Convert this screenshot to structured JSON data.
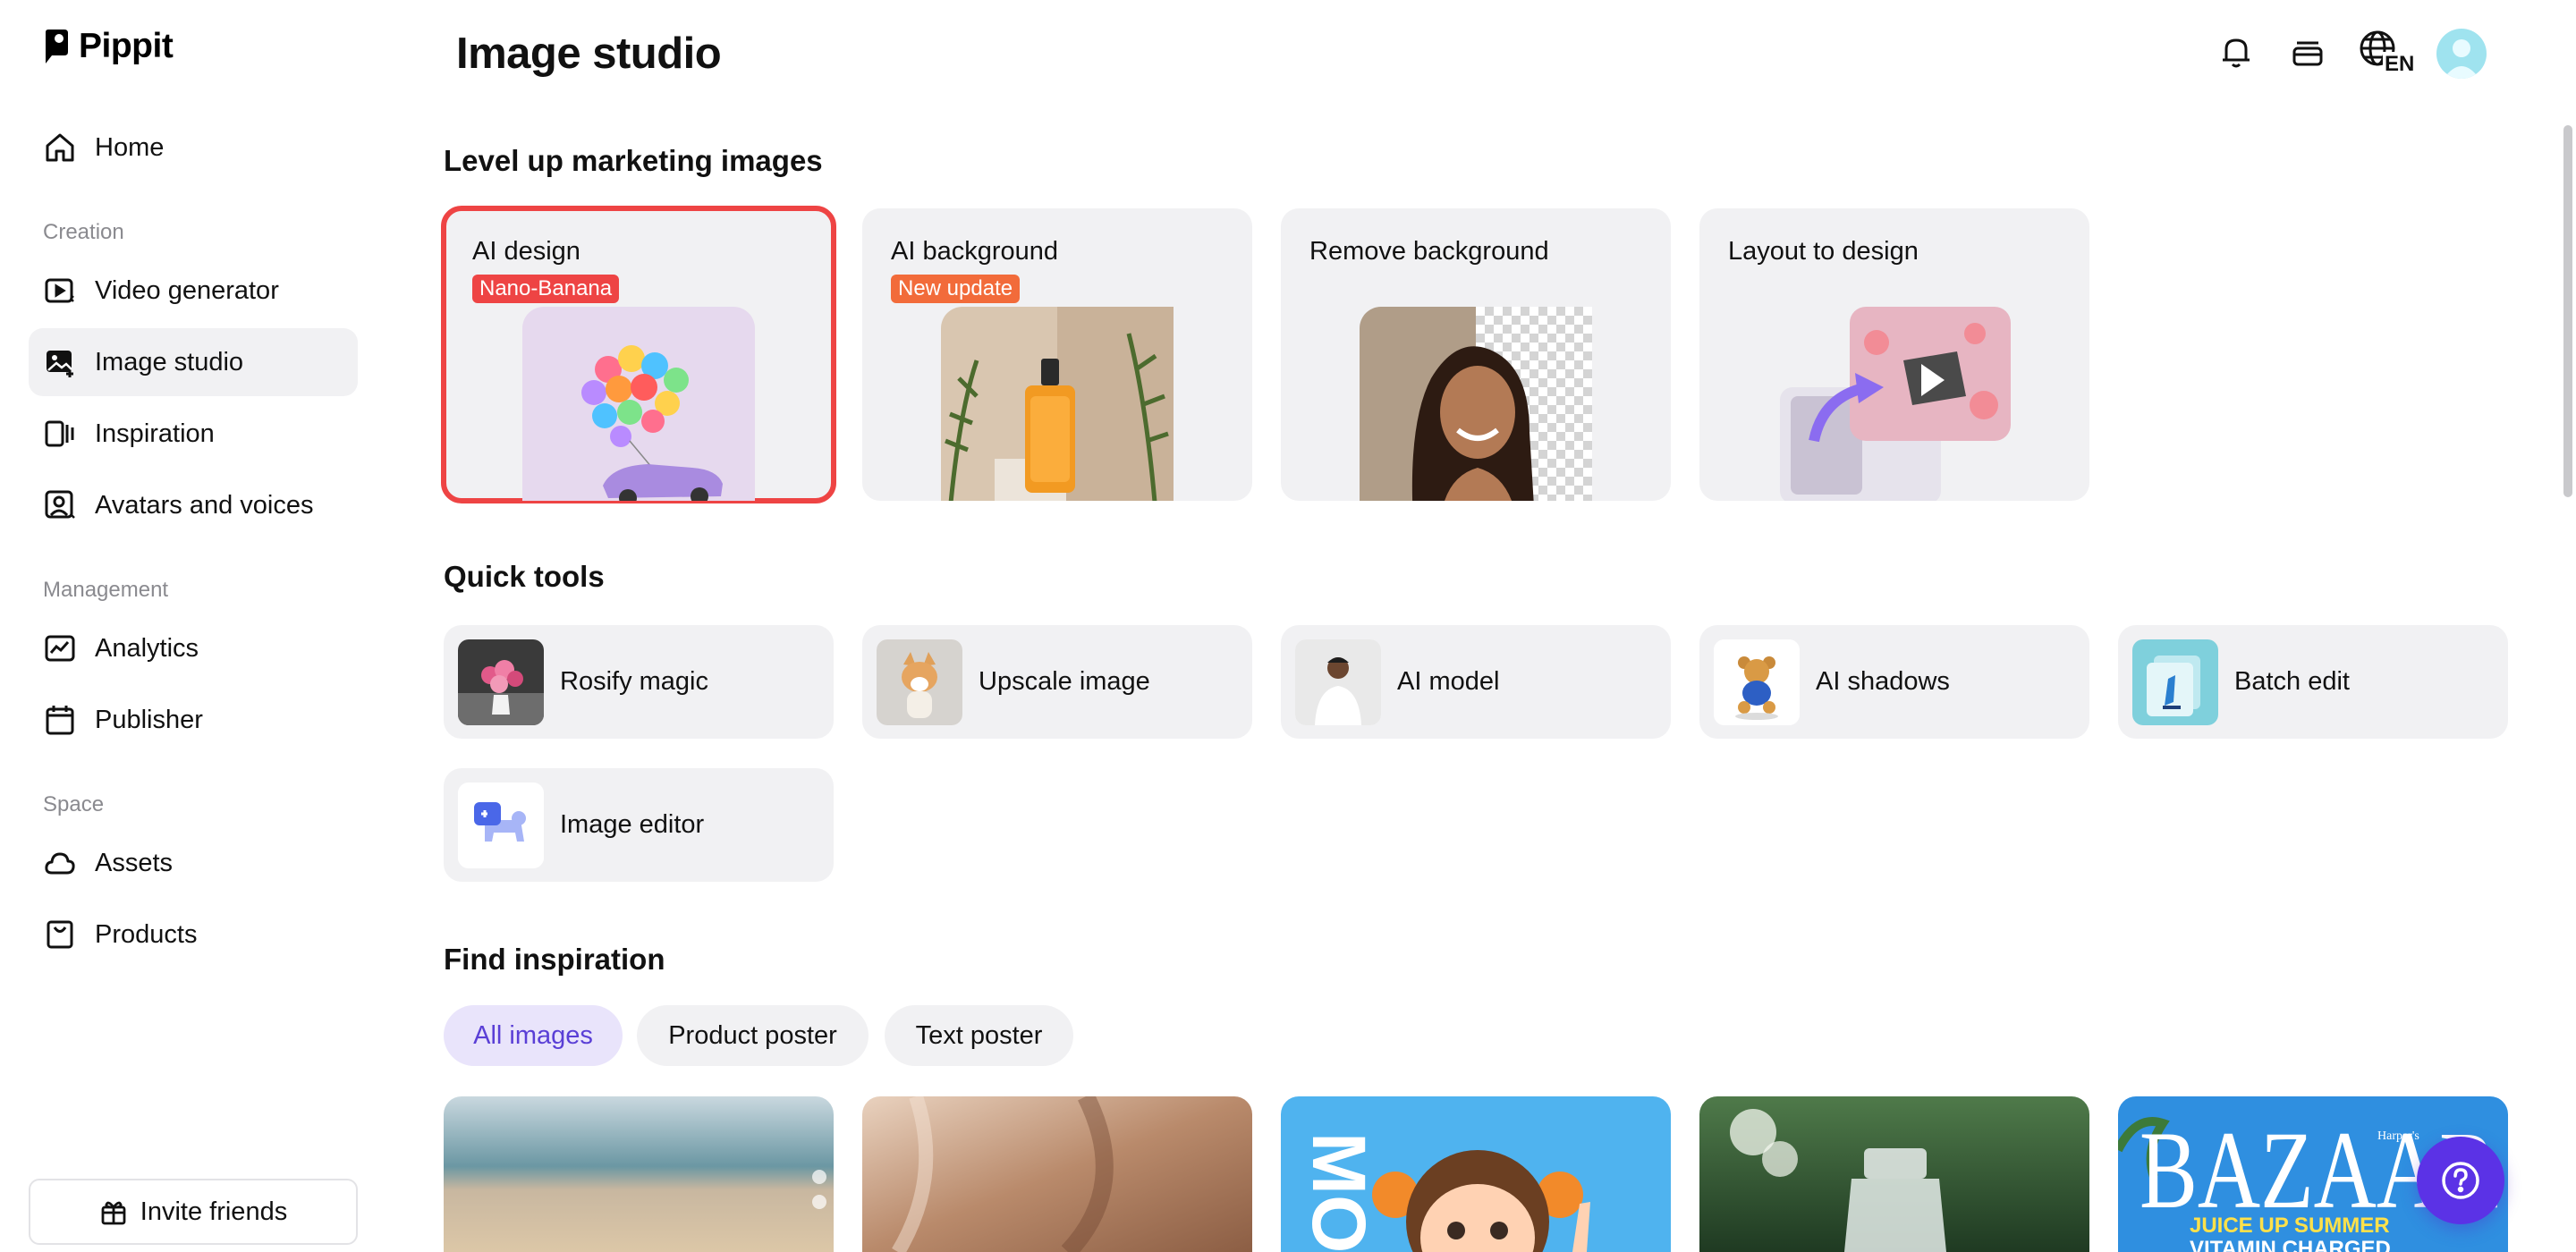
{
  "app": {
    "name": "Pippit"
  },
  "header": {
    "title": "Image studio",
    "language_badge": "EN"
  },
  "sidebar": {
    "items": [
      {
        "label": "Home",
        "icon": "home-icon"
      },
      {
        "label": "Video generator",
        "icon": "video-generator-icon"
      },
      {
        "label": "Image studio",
        "icon": "image-studio-icon",
        "active": true
      },
      {
        "label": "Inspiration",
        "icon": "inspiration-icon"
      },
      {
        "label": "Avatars and voices",
        "icon": "avatar-icon"
      },
      {
        "label": "Analytics",
        "icon": "analytics-icon"
      },
      {
        "label": "Publisher",
        "icon": "calendar-icon"
      },
      {
        "label": "Assets",
        "icon": "cloud-icon"
      },
      {
        "label": "Products",
        "icon": "product-bag-icon"
      }
    ],
    "sections": [
      "Creation",
      "Management",
      "Space"
    ],
    "invite_label": "Invite friends"
  },
  "marketing": {
    "title": "Level up marketing images",
    "cards": [
      {
        "title": "AI design",
        "badge": "Nano-Banana",
        "selected": true
      },
      {
        "title": "AI background",
        "badge": "New update"
      },
      {
        "title": "Remove background"
      },
      {
        "title": "Layout to design"
      }
    ]
  },
  "quick_tools": {
    "title": "Quick tools",
    "items": [
      {
        "label": "Rosify magic"
      },
      {
        "label": "Upscale image"
      },
      {
        "label": "AI model"
      },
      {
        "label": "AI shadows"
      },
      {
        "label": "Batch edit"
      },
      {
        "label": "Image editor"
      }
    ]
  },
  "inspiration": {
    "title": "Find inspiration",
    "filters": [
      {
        "label": "All images",
        "active": true
      },
      {
        "label": "Product poster"
      },
      {
        "label": "Text poster"
      }
    ],
    "tiles": [
      {
        "caption": ""
      },
      {
        "caption": ""
      },
      {
        "caption": "MO"
      },
      {
        "caption": ""
      },
      {
        "caption": "BAZAAR",
        "sub": "JUICE UP SUMMER",
        "sub2": "VITAMIN CHARGED",
        "tag": "Harper's"
      }
    ]
  },
  "colors": {
    "accent": "#5b32e6",
    "badge_red": "#ee4444",
    "badge_orange": "#f26b3a",
    "selected_outline": "#ee4444"
  }
}
